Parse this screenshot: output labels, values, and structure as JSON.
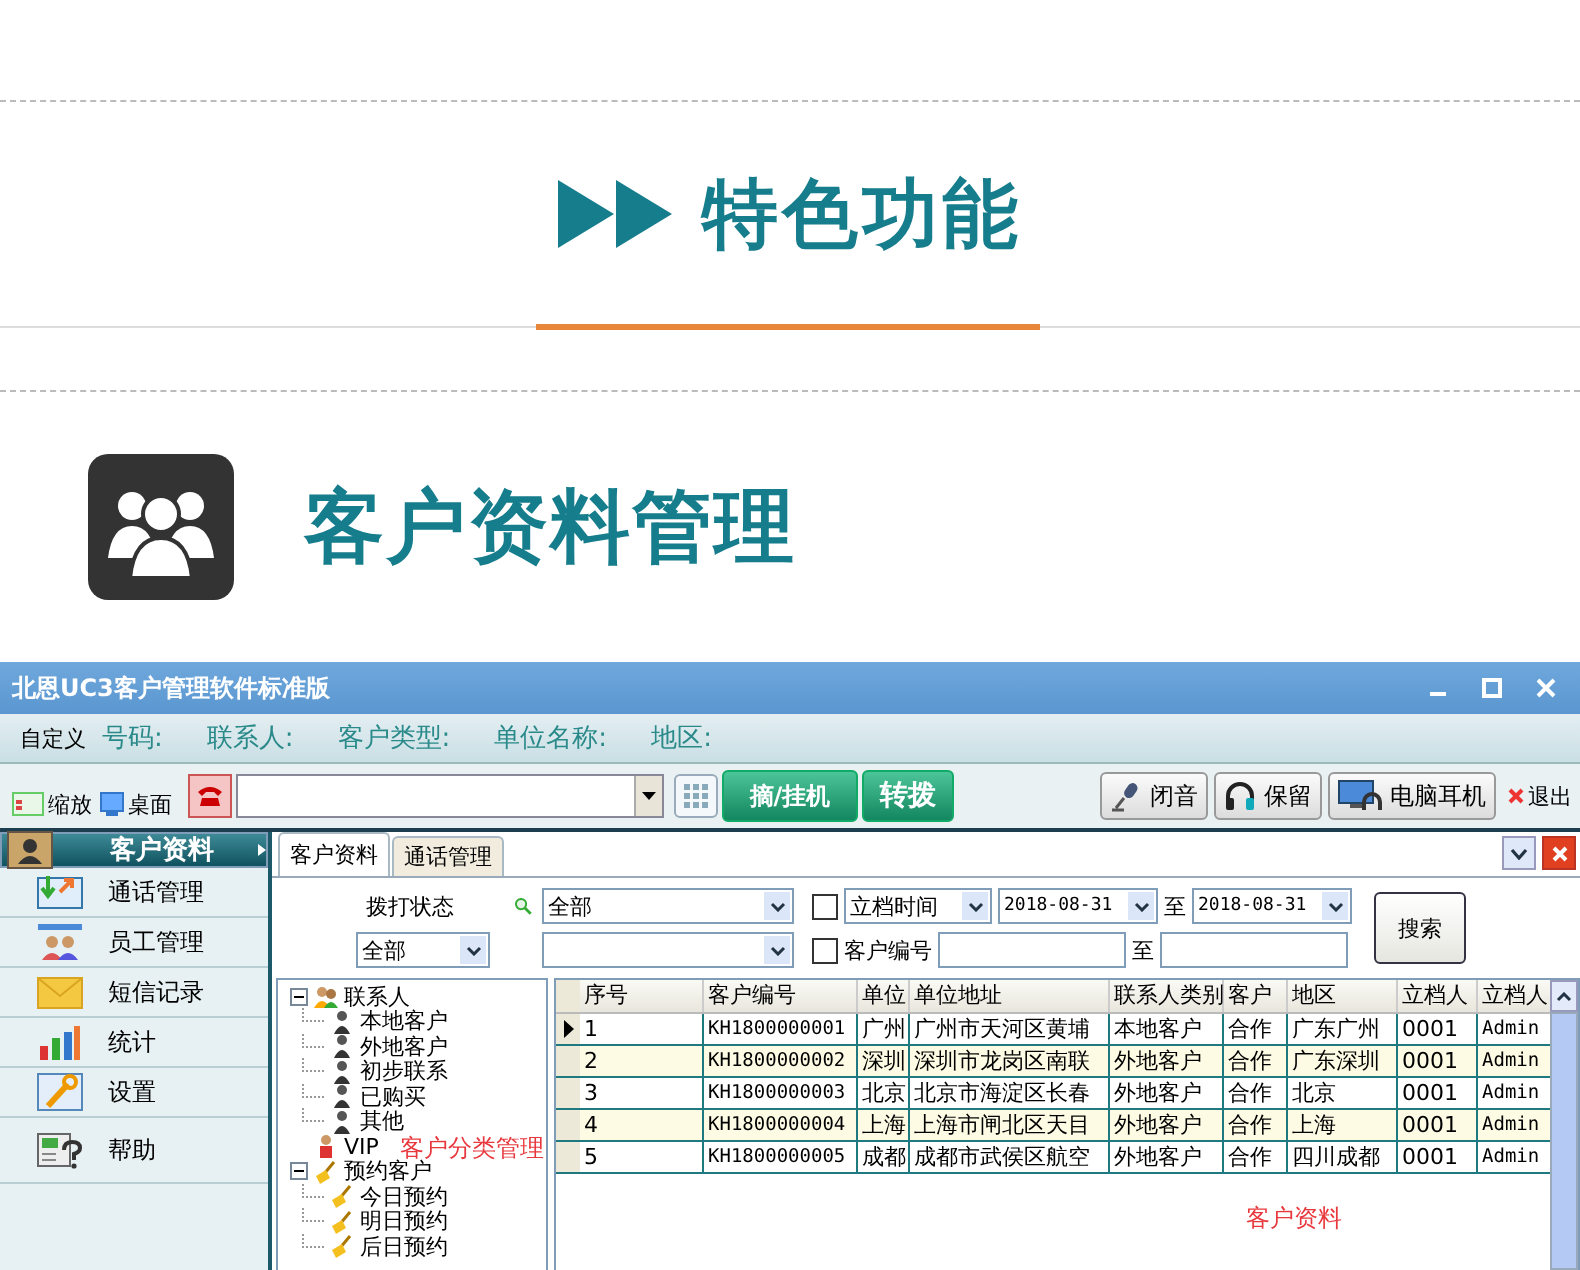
{
  "page_header": {
    "title": "特色功能"
  },
  "section": {
    "title": "客户资料管理"
  },
  "window": {
    "title": "北恩UC3客户管理软件标准版"
  },
  "label_bar": {
    "custom": "自定义",
    "labels": [
      "号码:",
      "联系人:",
      "客户类型:",
      "单位名称:",
      "地区:"
    ]
  },
  "toolbar": {
    "zoom": "缩放",
    "desktop": "桌面",
    "call_buttons": [
      "摘/挂机",
      "转拨"
    ],
    "audio_buttons": [
      "闭音",
      "保留",
      "电脑耳机"
    ],
    "exit": "退出"
  },
  "sidebar": {
    "items": [
      {
        "label": "客户资料",
        "selected": true
      },
      {
        "label": "通话管理",
        "selected": false
      },
      {
        "label": "员工管理",
        "selected": false
      },
      {
        "label": "短信记录",
        "selected": false
      },
      {
        "label": "统计",
        "selected": false
      },
      {
        "label": "设置",
        "selected": false
      },
      {
        "label": "帮助",
        "selected": false
      }
    ]
  },
  "tabs": [
    {
      "label": "客户资料",
      "selected": true
    },
    {
      "label": "通话管理",
      "selected": false
    }
  ],
  "filters": {
    "dial_status_label": "拨打状态",
    "dial_status": "全部",
    "field_select": "全部",
    "filed_time": {
      "checked": false,
      "value": "立档时间",
      "from": "2018-08-31",
      "to_label": "至",
      "to": "2018-08-31"
    },
    "customer_no": {
      "checked": false,
      "label": "客户编号",
      "to_label": "至"
    },
    "search_button": "搜索"
  },
  "tree": [
    {
      "label": "联系人",
      "kind": "group",
      "expanded": true,
      "children": [
        {
          "label": "本地客户",
          "kind": "person"
        },
        {
          "label": "外地客户",
          "kind": "person"
        },
        {
          "label": "初步联系",
          "kind": "person"
        },
        {
          "label": "已购买",
          "kind": "person"
        },
        {
          "label": "其他",
          "kind": "person"
        }
      ]
    },
    {
      "label": "VIP",
      "kind": "vip"
    },
    {
      "label": "预约客户",
      "kind": "appointment",
      "expanded": true,
      "children": [
        {
          "label": "今日预约",
          "kind": "appointment"
        },
        {
          "label": "明日预约",
          "kind": "appointment"
        },
        {
          "label": "后日预约",
          "kind": "appointment"
        }
      ]
    }
  ],
  "table": {
    "columns": [
      "序号",
      "客户编号",
      "单位",
      "单位地址",
      "联系人类别",
      "客户",
      "地区",
      "立档人",
      "立档人"
    ],
    "rows": [
      {
        "current": true,
        "cells": [
          "1",
          "KH1800000001",
          "广州",
          "广州市天河区黄埔",
          "本地客户",
          "合作",
          "广东广州",
          "0001",
          "Admin"
        ]
      },
      {
        "current": false,
        "cells": [
          "2",
          "KH1800000002",
          "深圳",
          "深圳市龙岗区南联",
          "外地客户",
          "合作",
          "广东深圳",
          "0001",
          "Admin"
        ]
      },
      {
        "current": false,
        "cells": [
          "3",
          "KH1800000003",
          "北京",
          "北京市海淀区长春",
          "外地客户",
          "合作",
          "北京",
          "0001",
          "Admin"
        ]
      },
      {
        "current": false,
        "cells": [
          "4",
          "KH1800000004",
          "上海",
          "上海市闸北区天目",
          "外地客户",
          "合作",
          "上海",
          "0001",
          "Admin"
        ]
      },
      {
        "current": false,
        "cells": [
          "5",
          "KH1800000005",
          "成都",
          "成都市武侯区航空",
          "外地客户",
          "合作",
          "四川成都",
          "0001",
          "Admin"
        ]
      }
    ]
  },
  "annotations": [
    "客户分类管理",
    "客户资料"
  ]
}
